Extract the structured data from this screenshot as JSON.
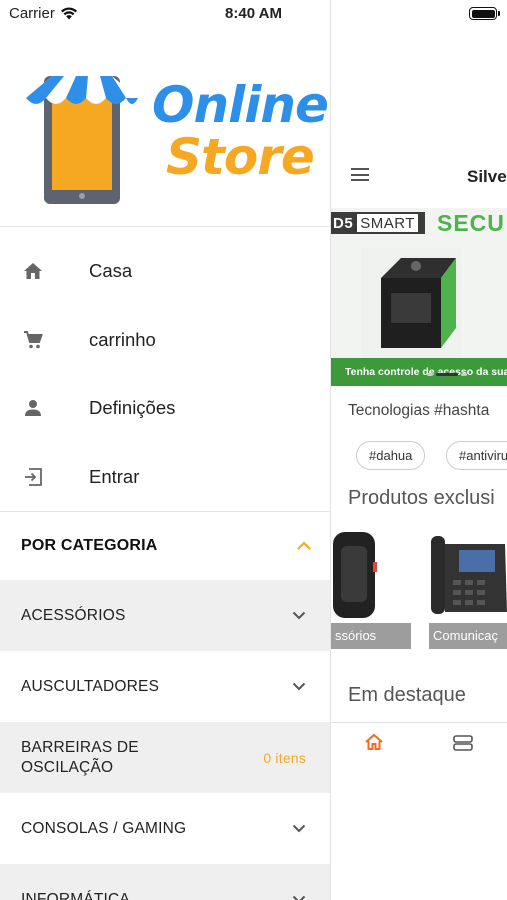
{
  "status_bar": {
    "carrier": "Carrier",
    "time": "8:40 AM"
  },
  "logo": {
    "line1": "Online",
    "line2": "Store"
  },
  "menu": [
    {
      "icon": "home-icon",
      "label": "Casa"
    },
    {
      "icon": "cart-icon",
      "label": "carrinho"
    },
    {
      "icon": "person-icon",
      "label": "Definições"
    },
    {
      "icon": "login-icon",
      "label": "Entrar"
    }
  ],
  "categories": {
    "header": "POR CATEGORIA",
    "items": [
      {
        "line1": "ACESSÓRIOS",
        "line2": "",
        "count": ""
      },
      {
        "line1": "AUSCULTADORES",
        "line2": "",
        "count": ""
      },
      {
        "line1": "BARREIRAS DE",
        "line2": "OSCILAÇÃO",
        "count": "0 itens"
      },
      {
        "line1": "CONSOLAS / GAMING",
        "line2": "",
        "count": ""
      },
      {
        "line1": "INFORMÁTICA",
        "line2": "",
        "count": ""
      }
    ]
  },
  "main": {
    "title": "Silve",
    "banner": {
      "brand1": "D5",
      "brand2": "SMART",
      "headline": "SECU",
      "tagline": "Tenha controle de acesso da sua"
    },
    "tech_title": "Tecnologias #hashta",
    "tags": [
      "#dahua",
      "#antiviru"
    ],
    "products_title": "Produtos exclusi",
    "products": [
      {
        "caption": "ssórios"
      },
      {
        "caption": "Comunicaç"
      }
    ],
    "featured_title": "Em destaque"
  },
  "colors": {
    "accent_orange": "#f7a823",
    "logo_blue": "#2d8fe8",
    "banner_green": "#4db34a"
  }
}
